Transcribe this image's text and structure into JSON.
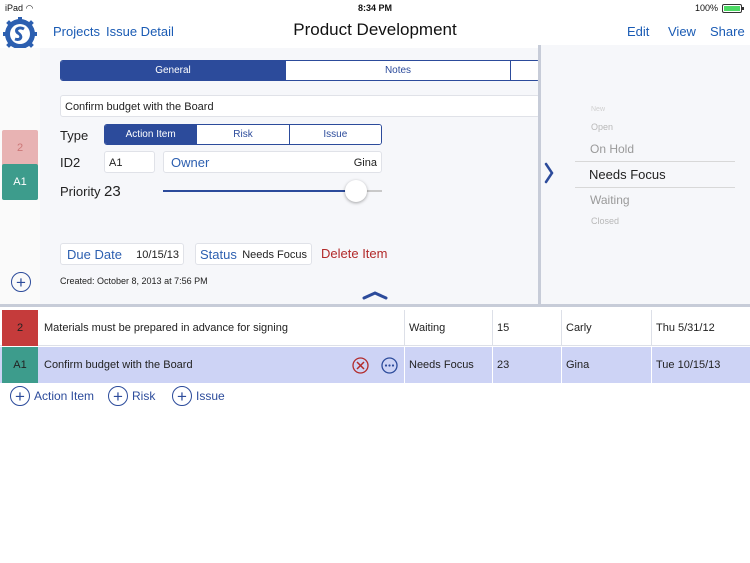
{
  "status_bar": {
    "carrier": "iPad",
    "time": "8:34 PM",
    "battery": "100%"
  },
  "nav": {
    "projects": "Projects",
    "issue_detail": "Issue Detail",
    "title": "Product Development",
    "edit": "Edit",
    "view": "View",
    "share": "Share"
  },
  "left_tiles": [
    {
      "label": "2",
      "color": "#e8b3b3"
    },
    {
      "label": "A1",
      "color": "#3d9c8c"
    }
  ],
  "detail": {
    "tabs": [
      "General",
      "Notes"
    ],
    "title_value": "Confirm budget with the Board",
    "type_label": "Type",
    "type_options": [
      "Action Item",
      "Risk",
      "Issue"
    ],
    "id2_label": "ID2",
    "id2_value": "A1",
    "owner_label": "Owner",
    "owner_value": "Gina",
    "priority_label": "Priority",
    "priority_value": "23",
    "due_label": "Due Date",
    "due_value": "10/15/13",
    "status_label": "Status",
    "status_value": "Needs Focus",
    "delete_label": "Delete Item",
    "created": "Created: October 8, 2013 at 7:56 PM"
  },
  "picker": {
    "options": [
      "New",
      "Open",
      "On Hold",
      "Needs Focus",
      "Waiting",
      "Closed"
    ],
    "selected": "Needs Focus"
  },
  "rows": [
    {
      "id": "2",
      "id_color": "#c53b3b",
      "title": "Materials must be prepared in advance for signing",
      "status": "Waiting",
      "priority": "15",
      "owner": "Carly",
      "date": "Thu 5/31/12"
    },
    {
      "id": "A1",
      "id_color": "#3d9c8c",
      "title": "Confirm budget with the Board",
      "status": "Needs Focus",
      "priority": "23",
      "owner": "Gina",
      "date": "Tue 10/15/13"
    }
  ],
  "add_buttons": [
    "Action Item",
    "Risk",
    "Issue"
  ],
  "colors": {
    "accent": "#2c4b9b",
    "link": "#1a5bb4",
    "delete": "#b22a2a",
    "selected_row": "#cdd3f5"
  }
}
